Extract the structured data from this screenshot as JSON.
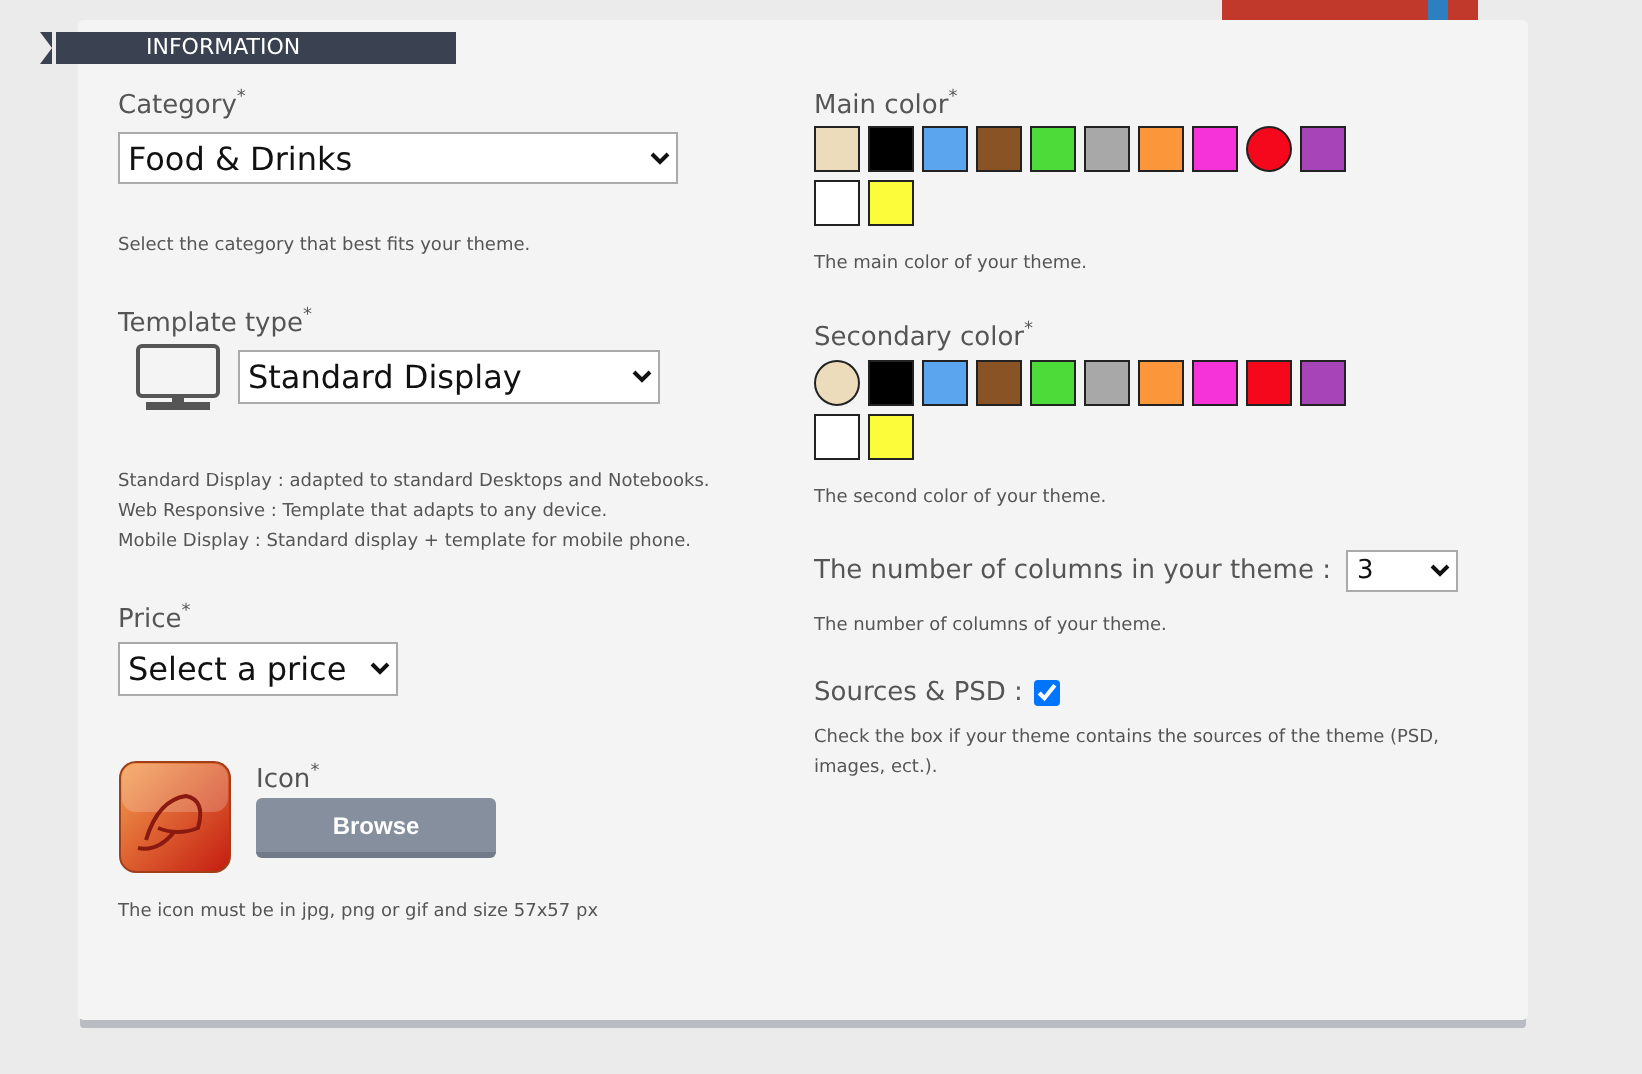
{
  "section_title": "INFORMATION",
  "category": {
    "label": "Category",
    "required": "*",
    "value": "Food & Drinks",
    "help": "Select the category that best fits your theme."
  },
  "template_type": {
    "label": "Template type",
    "required": "*",
    "value": "Standard Display",
    "help": [
      "Standard Display : adapted to standard Desktops and Notebooks.",
      "Web Responsive : Template that adapts to any device.",
      "Mobile Display : Standard display + template for mobile phone."
    ]
  },
  "price": {
    "label": "Price",
    "required": "*",
    "value": "Select a price"
  },
  "icon": {
    "label": "Icon",
    "required": "*",
    "button": "Browse",
    "help": "The icon must be in jpg, png or gif and size 57x57 px"
  },
  "main_color": {
    "label": "Main color",
    "required": "*",
    "help": "The main color of your theme.",
    "swatches": [
      {
        "color": "#ecdcbc",
        "selected": false
      },
      {
        "color": "#000000",
        "selected": false
      },
      {
        "color": "#5ba5ee",
        "selected": false
      },
      {
        "color": "#8a5325",
        "selected": false
      },
      {
        "color": "#4ddb3a",
        "selected": false
      },
      {
        "color": "#a8a8a8",
        "selected": false
      },
      {
        "color": "#fc963a",
        "selected": false
      },
      {
        "color": "#f533d9",
        "selected": false
      },
      {
        "color": "#f5081c",
        "selected": true
      },
      {
        "color": "#a644b8",
        "selected": false
      },
      {
        "color": "#ffffff",
        "selected": false
      },
      {
        "color": "#fcfc3a",
        "selected": false
      }
    ]
  },
  "secondary_color": {
    "label": "Secondary color",
    "required": "*",
    "help": "The second color of your theme.",
    "swatches": [
      {
        "color": "#ecdcbc",
        "selected": true
      },
      {
        "color": "#000000",
        "selected": false
      },
      {
        "color": "#5ba5ee",
        "selected": false
      },
      {
        "color": "#8a5325",
        "selected": false
      },
      {
        "color": "#4ddb3a",
        "selected": false
      },
      {
        "color": "#a8a8a8",
        "selected": false
      },
      {
        "color": "#fc963a",
        "selected": false
      },
      {
        "color": "#f533d9",
        "selected": false
      },
      {
        "color": "#f5081c",
        "selected": false
      },
      {
        "color": "#a644b8",
        "selected": false
      },
      {
        "color": "#ffffff",
        "selected": false
      },
      {
        "color": "#fcfc3a",
        "selected": false
      }
    ]
  },
  "columns": {
    "label": "The number of columns in your theme :",
    "value": "3",
    "help": "The number of columns of your theme."
  },
  "sources": {
    "label": "Sources & PSD :",
    "checked": true,
    "help": "Check the box if your theme contains the sources of the theme (PSD, images, ect.)."
  }
}
